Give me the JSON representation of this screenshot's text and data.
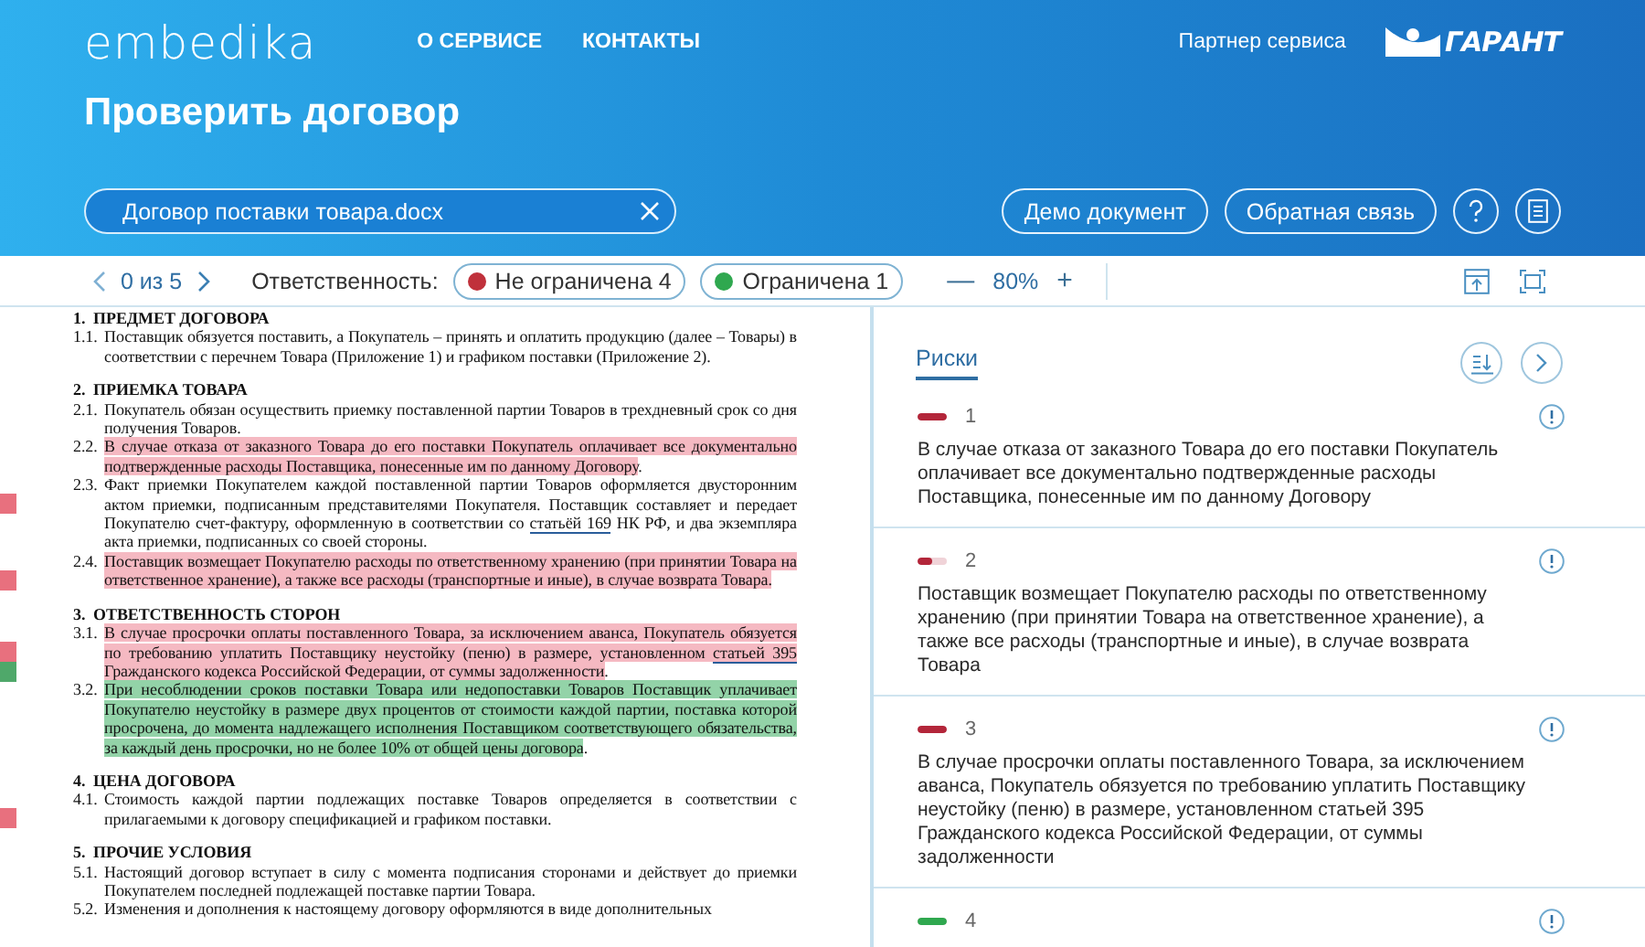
{
  "header": {
    "logo": "embedika",
    "nav": [
      {
        "label": "О СЕРВИСЕ"
      },
      {
        "label": "КОНТАКТЫ"
      }
    ],
    "partner_label": "Партнер сервиса",
    "partner_logo": "ГАРАНТ",
    "title": "Проверить договор",
    "file_field": {
      "value": "Договор поставки товара.docx"
    },
    "buttons": [
      {
        "label": "Демо документ"
      },
      {
        "label": "Обратная связь"
      }
    ]
  },
  "toolbar": {
    "counter": "0 из 5",
    "responsibility_label": "Ответственность:",
    "filters": [
      {
        "label": "Не ограничена 4",
        "color": "#c0313b"
      },
      {
        "label": "Ограничена 1",
        "color": "#2fa84f"
      }
    ],
    "zoom_minus": "—",
    "zoom": "80%",
    "zoom_plus": "+"
  },
  "document": {
    "sections": [
      {
        "heading": "1.  ПРЕДМЕТ ДОГОВОРА",
        "clauses": [
          {
            "number": "1.1.",
            "segments": [
              {
                "text": "Поставщик обязуется поставить, а Покупатель – принять и оплатить продукцию (далее – Товары) в соответствии с перечнем Товара (Приложение 1) и графиком поставки (Приложение 2)."
              }
            ]
          }
        ]
      },
      {
        "heading": "2.  ПРИЕМКА ТОВАРА",
        "clauses": [
          {
            "number": "2.1.",
            "segments": [
              {
                "text": "Покупатель обязан осуществить приемку поставленной партии Товаров в трехдневный срок со дня получения Товаров."
              }
            ]
          },
          {
            "number": "2.2.",
            "segments": [
              {
                "text": "В случае отказа от заказного Товара до его поставки Покупатель оплачивает все документально подтвержденные расходы Поставщика, понесенные им по данному Договору",
                "color": "#f5b9c2"
              },
              {
                "text": "."
              }
            ]
          },
          {
            "number": "2.3.",
            "markers": [
              {
                "color": "#e8707e"
              }
            ],
            "segments": [
              {
                "text": "Факт приемки Покупателем каждой поставленной партии Товаров оформляется двусторонним актом приемки, подписанным представителями Покупателя. Поставщик составляет и передает Покупателю счет-фактуру, оформленную в соответствии со "
              },
              {
                "text": "статьёй 169",
                "link": true
              },
              {
                "text": " НК РФ, и два экземпляра акта приемки, подписанных со своей стороны."
              }
            ]
          },
          {
            "number": "2.4.",
            "markers": [
              {
                "color": "#e8707e"
              }
            ],
            "segments": [
              {
                "text": "Поставщик возмещает Покупателю расходы по ответственному хранению (при принятии Товара на ответственное хранение), а также все расходы (транспортные и иные), в случае возврата Товара.",
                "color": "#f5b9c2"
              }
            ]
          }
        ]
      },
      {
        "heading": "3.  ОТВЕТСТВЕННОСТЬ СТОРОН",
        "clauses": [
          {
            "number": "3.1.",
            "markers": [
              {
                "color": "#e8707e"
              },
              {
                "color": "#4fa86a"
              }
            ],
            "segments": [
              {
                "text": "В случае просрочки оплаты поставленного Товара, за исключением аванса, Покупатель обязуется по требованию уплатить Поставщику неустойку (пеню) в размере, установленном ",
                "color": "#f5b9c2"
              },
              {
                "text": "статьей 395",
                "color": "#f5b9c2",
                "link": true
              },
              {
                "text": " Гражданского кодекса Российской Федерации, от суммы задолженности",
                "color": "#f5b9c2"
              },
              {
                "text": "."
              }
            ]
          },
          {
            "number": "3.2.",
            "segments": [
              {
                "text": "При несоблюдении сроков поставки Товара или недопоставки Товаров Поставщик уплачивает Покупателю неустойку в размере двух процентов от стоимости каждой партии, поставка которой просрочена, до момента надлежащего исполнения Поставщиком соответствующего обязательства, за каждый день просрочки, но не более 10% от общей цены договора",
                "color": "#93d3a8"
              },
              {
                "text": "."
              }
            ]
          }
        ]
      },
      {
        "heading": "4.  ЦЕНА ДОГОВОРА",
        "clauses": [
          {
            "number": "4.1.",
            "markers": [
              {
                "color": "#e8707e"
              }
            ],
            "segments": [
              {
                "text": "Стоимость каждой партии подлежащих поставке Товаров определяется в соответствии с прилагаемыми к договору спецификацией и графиком поставки."
              }
            ]
          }
        ]
      },
      {
        "heading": "5.  ПРОЧИЕ УСЛОВИЯ",
        "clauses": [
          {
            "number": "5.1.",
            "segments": [
              {
                "text": "Настоящий договор вступает в силу с момента подписания сторонами и действует до приемки Покупателем последней подлежащей поставке партии Товара."
              }
            ]
          },
          {
            "number": "5.2.",
            "segments": [
              {
                "text": "Изменения и дополнения к настоящему договору оформляются в виде дополнительных"
              }
            ]
          }
        ]
      }
    ]
  },
  "risks": {
    "tab": {
      "label": "Риски",
      "selected": true
    },
    "items": [
      {
        "number": "1",
        "color": "#b3263a",
        "level": 1,
        "text": "В случае отказа от заказного Товара до его поставки Покупатель оплачивает все документально подтвержденные расходы Поставщика, понесенные им по данному Договору"
      },
      {
        "number": "2",
        "color": "#b3263a",
        "level": 0.5,
        "text": "Поставщик возмещает Покупателю расходы по ответственному хранению (при принятии Товара на ответственное хранение), а также все расходы (транспортные и иные), в случае возврата Товара"
      },
      {
        "number": "3",
        "color": "#b3263a",
        "level": 1,
        "text": "В случае просрочки оплаты поставленного Товара, за исключением аванса, Покупатель обязуется по требованию уплатить Поставщику неустойку (пеню) в размере, установленном статьей 395 Гражданского кодекса Российской Федерации, от суммы задолженности"
      },
      {
        "number": "4",
        "color": "#2fa84f",
        "level": 1
      }
    ]
  }
}
